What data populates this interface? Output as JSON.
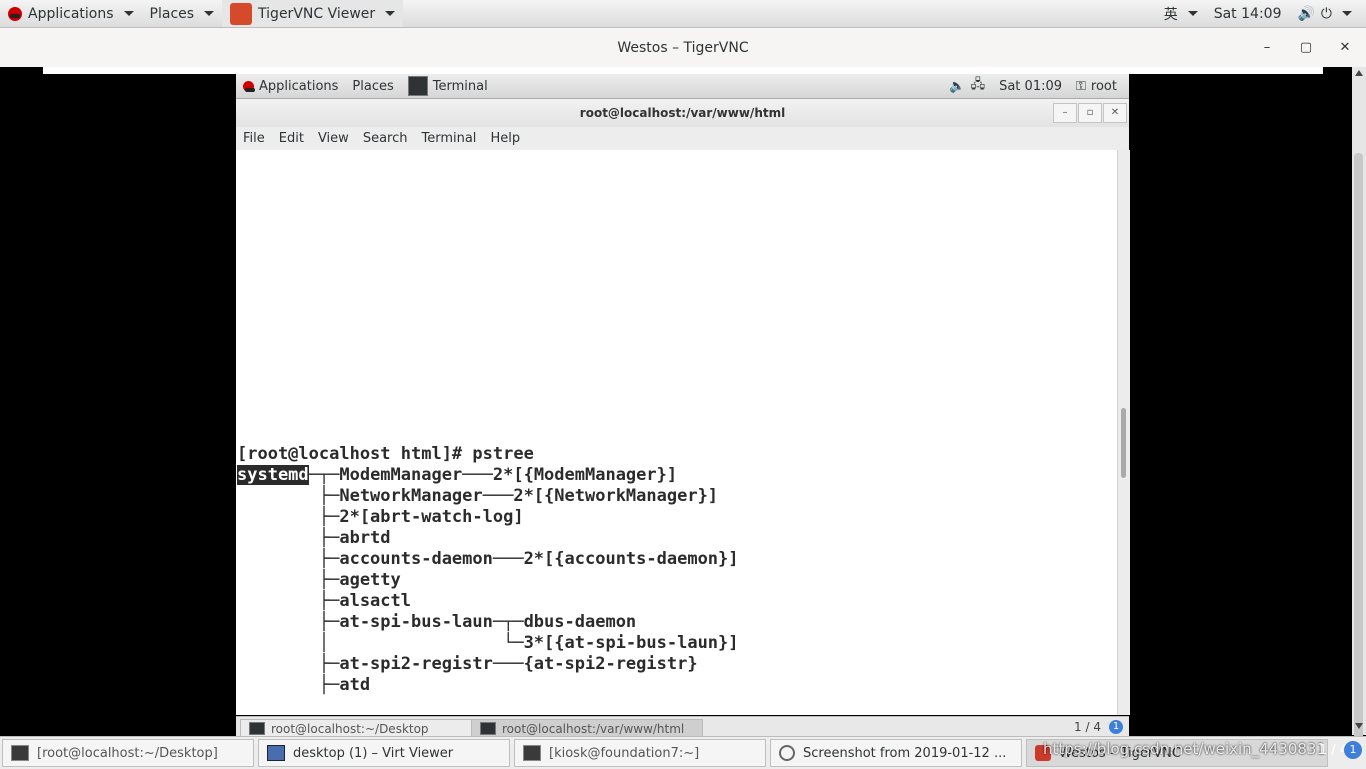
{
  "host_panel": {
    "applications": "Applications",
    "places": "Places",
    "active_app": "TigerVNC Viewer",
    "input_method": "英",
    "clock": "Sat 14:09"
  },
  "vnc_window": {
    "title": "Westos – TigerVNC",
    "minimize": "–",
    "maximize": "▢",
    "close": "✕"
  },
  "remote_panel": {
    "applications": "Applications",
    "places": "Places",
    "active_app": "Terminal",
    "clock": "Sat 01:09",
    "user": "root"
  },
  "terminal": {
    "title": "root@localhost:/var/www/html",
    "menu": [
      "File",
      "Edit",
      "View",
      "Search",
      "Terminal",
      "Help"
    ],
    "prompt": "[root@localhost html]# pstree",
    "selected_root": "systemd",
    "lines": [
      "─┬─ModemManager───2*[{ModemManager}]",
      "        ├─NetworkManager───2*[{NetworkManager}]",
      "        ├─2*[abrt-watch-log]",
      "        ├─abrtd",
      "        ├─accounts-daemon───2*[{accounts-daemon}]",
      "        ├─agetty",
      "        ├─alsactl",
      "        ├─at-spi-bus-laun─┬─dbus-daemon",
      "        │                 └─3*[{at-spi-bus-laun}]",
      "        ├─at-spi2-registr───{at-spi2-registr}",
      "        ├─atd"
    ]
  },
  "remote_taskbar": {
    "items": [
      "root@localhost:~/Desktop",
      "root@localhost:/var/www/html"
    ],
    "pager": "1 / 4",
    "pager_badge": "1"
  },
  "host_taskbar": {
    "items": [
      "[root@localhost:~/Desktop]",
      "desktop (1) – Virt Viewer",
      "[kiosk@foundation7:~]",
      "Screenshot from 2019-01-12 ...",
      "Westos – TigerVNC"
    ],
    "watermark": "https://blog.csdn.net/weixin_4430831",
    "pager": "1 / 4",
    "pager_badge": "1"
  }
}
